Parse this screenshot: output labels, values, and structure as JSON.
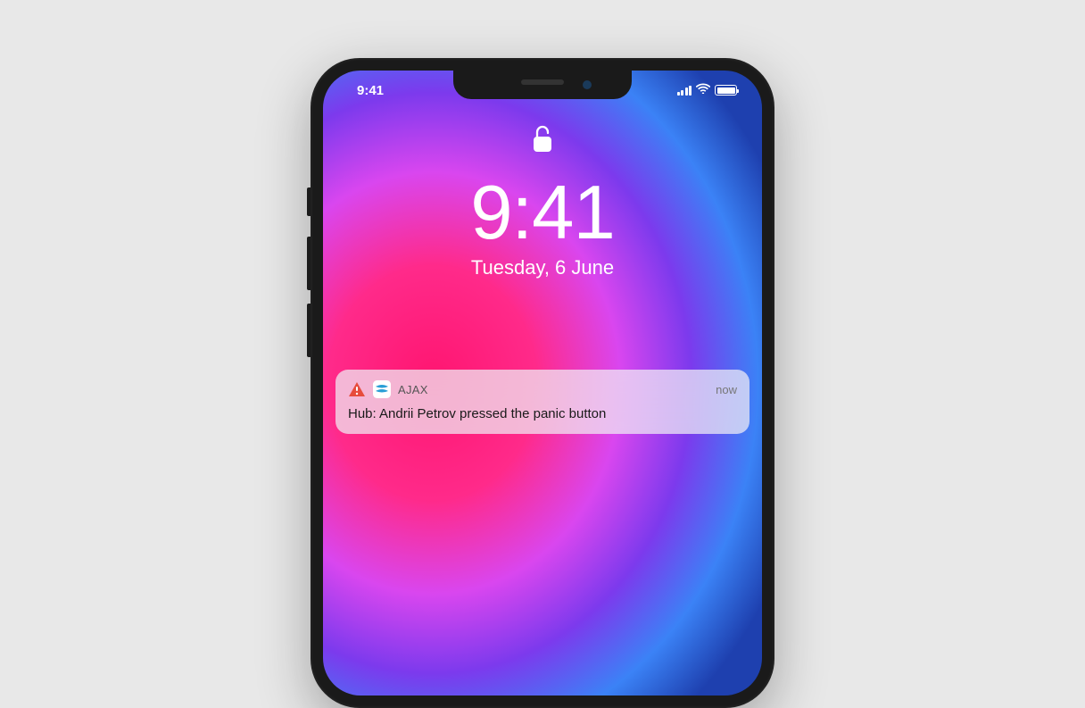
{
  "status_bar": {
    "time": "9:41"
  },
  "lockscreen": {
    "clock": "9:41",
    "date": "Tuesday, 6 June"
  },
  "notification": {
    "app_name": "AJAX",
    "timestamp": "now",
    "body": "Hub: Andrii Petrov pressed the panic button"
  }
}
